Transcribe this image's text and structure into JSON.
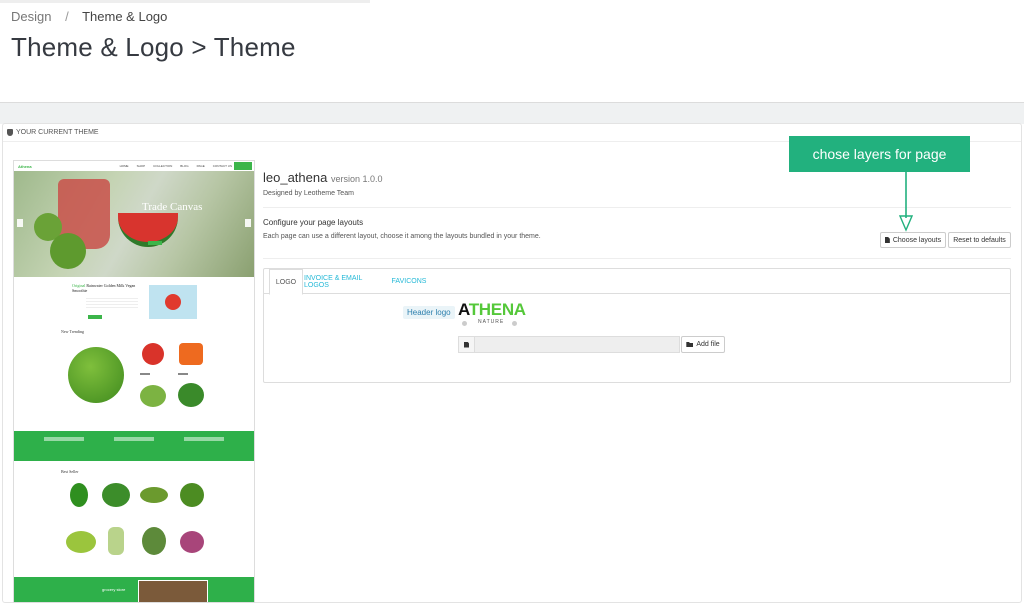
{
  "breadcrumb": {
    "parent": "Design",
    "separator": "/",
    "current": "Theme & Logo"
  },
  "page_title": "Theme & Logo > Theme",
  "panel_heading": "YOUR CURRENT THEME",
  "theme": {
    "name": "leo_athena",
    "version": "version 1.0.0",
    "designed_by": "Designed by Leotheme Team"
  },
  "layouts": {
    "title": "Configure your page layouts",
    "description": "Each page can use a different layout, choose it among the layouts bundled in your theme.",
    "choose_button": "Choose layouts",
    "reset_button": "Reset to defaults"
  },
  "tabs": [
    {
      "label": "LOGO",
      "active": true
    },
    {
      "label": "INVOICE & EMAIL LOGOS",
      "active": false
    },
    {
      "label": "FAVICONS",
      "active": false
    }
  ],
  "logo_tab": {
    "label": "Header logo",
    "logo_text_a": "A",
    "logo_text_rest": "THENA",
    "logo_sub": "NATURE",
    "add_file_button": "Add file",
    "file_value": ""
  },
  "annotation": {
    "callout": "chose layers for page"
  },
  "preview": {
    "logo": "Athena",
    "menu": [
      "HOME",
      "SHOP",
      "COLLECTION",
      "BLOG",
      "PAGE",
      "CONTACT US"
    ],
    "hero_small": "Trade Canvas",
    "hero_title": "Trade Canvas",
    "feature_title_green": "Original",
    "feature_title_rest": "Rainwater Golden Milk Vegan Smoothie",
    "section_new": "New Trending",
    "section_best": "Best Seller",
    "band_bottom_text": "grocery store"
  },
  "colors": {
    "accent": "#25b9d7",
    "brand_green": "#3cb54a",
    "callout": "#22b17e",
    "logo_green": "#55c83a"
  }
}
